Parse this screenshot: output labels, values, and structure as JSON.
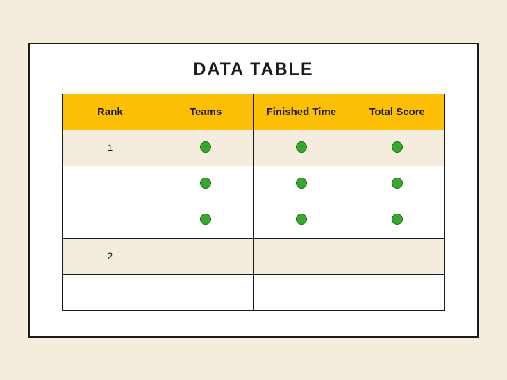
{
  "title": "DATA TABLE",
  "columns": [
    "Rank",
    "Teams",
    "Finished Time",
    "Total Score"
  ],
  "rows": [
    {
      "tint": true,
      "rank": "1",
      "teams_dot": true,
      "time_dot": true,
      "score_dot": true
    },
    {
      "tint": false,
      "rank": "",
      "teams_dot": true,
      "time_dot": true,
      "score_dot": true
    },
    {
      "tint": false,
      "rank": "",
      "teams_dot": true,
      "time_dot": true,
      "score_dot": true
    },
    {
      "tint": true,
      "rank": "2",
      "teams_dot": false,
      "time_dot": false,
      "score_dot": false
    },
    {
      "tint": false,
      "rank": "",
      "teams_dot": false,
      "time_dot": false,
      "score_dot": false
    }
  ]
}
